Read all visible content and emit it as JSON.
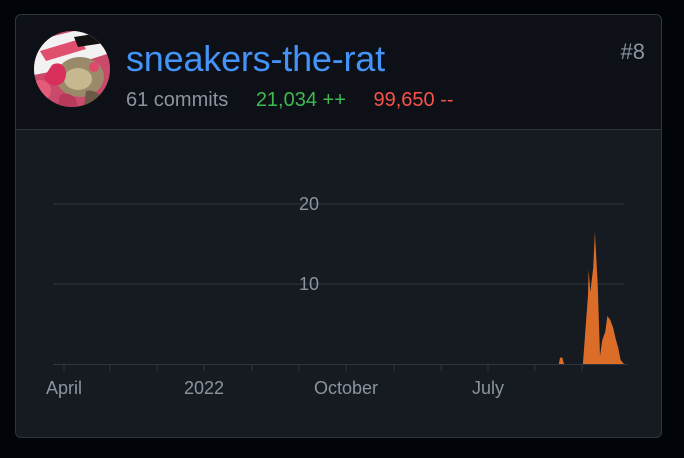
{
  "contributor": {
    "username": "sneakers-the-rat",
    "rank": "#8",
    "commits": "61 commits",
    "additions": "21,034 ++",
    "deletions": "99,650 --",
    "avatar_icon": "user-avatar"
  },
  "colors": {
    "link": "#4493f8",
    "additions": "#3fb950",
    "deletions": "#f85149",
    "area": "#db6d28",
    "muted": "#8b949e"
  },
  "chart_data": {
    "type": "area",
    "x_ticks": [
      "April",
      "2022",
      "October",
      "July"
    ],
    "y_ticks": [
      10,
      20
    ],
    "ylim": [
      0,
      20
    ],
    "grid": true,
    "series": [
      {
        "x": [
          0,
          0.886,
          0.888,
          0.89,
          0.892,
          0.895,
          0.919,
          0.928,
          0.937,
          0.938,
          0.941,
          0.946,
          0.949,
          0.954,
          0.958,
          0.962,
          0.967,
          0.971,
          0.976,
          0.981,
          0.986,
          0.99,
          0.994,
          1
        ],
        "y": [
          0,
          0,
          0.8,
          0.8,
          0.8,
          0,
          0,
          0,
          8.6,
          11.8,
          9,
          12,
          16.5,
          10,
          1,
          3,
          4,
          6,
          5.5,
          4.5,
          3,
          2,
          0.5,
          0
        ]
      }
    ]
  }
}
